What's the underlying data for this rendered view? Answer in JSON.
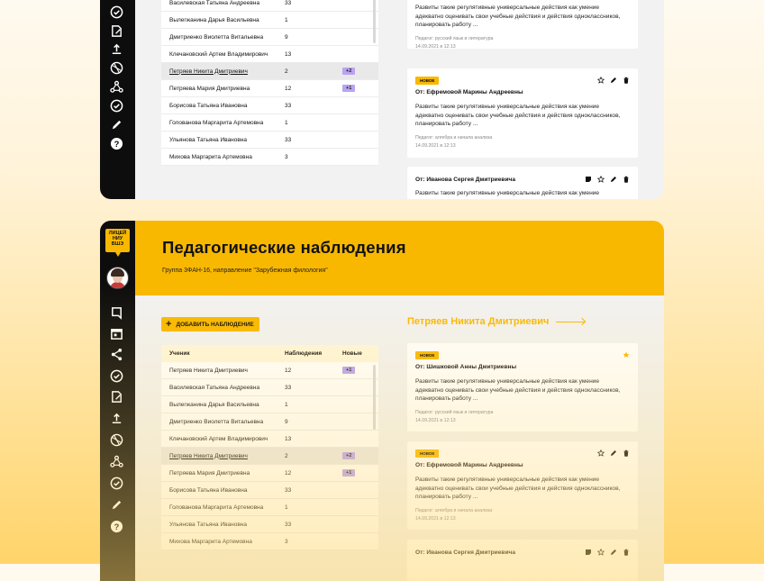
{
  "top_panel": {
    "table_rows": [
      {
        "name": "Василевская Татьяна Андреевна",
        "count": "33",
        "badge": "",
        "selected": false
      },
      {
        "name": "Вылегжанина Дарья Васильевна",
        "count": "1",
        "badge": "",
        "selected": false
      },
      {
        "name": "Дмитриенко Виолетта Витальевна",
        "count": "9",
        "badge": "",
        "selected": false
      },
      {
        "name": "Клечановский Артем Владимирович",
        "count": "13",
        "badge": "",
        "selected": false
      },
      {
        "name": "Петряев Никита Дмитриевич",
        "count": "2",
        "badge": "+2",
        "selected": true
      },
      {
        "name": "Петряева Мария Дмитриевна",
        "count": "12",
        "badge": "+1",
        "selected": false
      },
      {
        "name": "Борисова Татьяна Ивановна",
        "count": "33",
        "badge": "",
        "selected": false
      },
      {
        "name": "Голованова Маргарита Артемовна",
        "count": "1",
        "badge": "",
        "selected": false
      },
      {
        "name": "Ульянова Татьяна Ивановна",
        "count": "33",
        "badge": "",
        "selected": false
      },
      {
        "name": "Михова Маргарита Артемовна",
        "count": "3",
        "badge": "",
        "selected": false
      }
    ],
    "cards": [
      {
        "new": "",
        "from": "",
        "text": "Развиты такие регулятивные универсальные действия как умение адекватно оценивать свои учебные действия и действия одноклассников,  планировать работу ...",
        "subject": "Педагог: русский язык и литература",
        "date": "14.09.2021 в 12:13"
      },
      {
        "new": "НОВОЕ",
        "from": "От: Ефремовой Марины Андреевны",
        "text": "Развиты такие регулятивные универсальные действия как умение адекватно оценивать свои учебные действия и действия одноклассников,  планировать работу ...",
        "subject": "Педагог: алгебра и начала анализа",
        "date": "14.09.2021 в 12:13"
      },
      {
        "new": "",
        "from": "От: Иванова Сергея Дмитриевича",
        "text": "Развиты такие регулятивные универсальные действия как умение адекватно оценивать свои учебные действия и действия",
        "subject": "",
        "date": ""
      }
    ]
  },
  "bottom_panel": {
    "logo_text": [
      "ЛИЦЕЙ",
      "НИУ",
      "ВШЭ"
    ],
    "title": "Педагогические наблюдения",
    "subtitle": "Группа 3ФАН-16, направление \"Зарубежная филология\"",
    "add_button": "ДОБАВИТЬ НАБЛЮДЕНИЕ",
    "student_name": "Петряев Никита Дмитриевич",
    "table_headers": {
      "student": "Ученик",
      "observations": "Наблюдения",
      "new": "Новые"
    },
    "table_rows": [
      {
        "name": "Петряев Никита Дмитриевич",
        "count": "12",
        "badge": "+1",
        "selected": false
      },
      {
        "name": "Василевская Татьяна Андреевна",
        "count": "33",
        "badge": "",
        "selected": false
      },
      {
        "name": "Вылегжанина Дарья Васильевна",
        "count": "1",
        "badge": "",
        "selected": false
      },
      {
        "name": "Дмитриенко Виолетта Витальевна",
        "count": "9",
        "badge": "",
        "selected": false
      },
      {
        "name": "Клечановский Артем Владимирович",
        "count": "13",
        "badge": "",
        "selected": false
      },
      {
        "name": "Петряев Никита Дмитриевич",
        "count": "2",
        "badge": "+2",
        "selected": true
      },
      {
        "name": "Петряева Мария Дмитриевна",
        "count": "12",
        "badge": "+1",
        "selected": false
      },
      {
        "name": "Борисова Татьяна Ивановна",
        "count": "33",
        "badge": "",
        "selected": false
      },
      {
        "name": "Голованова Маргарита Артемовна",
        "count": "1",
        "badge": "",
        "selected": false
      },
      {
        "name": "Ульянова Татьяна Ивановна",
        "count": "33",
        "badge": "",
        "selected": false
      },
      {
        "name": "Михова Маргарита Артемовна",
        "count": "3",
        "badge": "",
        "selected": false
      }
    ],
    "cards": [
      {
        "new": "НОВОЕ",
        "from": "От: Шишковой Анны Дмитриевны",
        "text": "Развиты такие регулятивные универсальные действия как умение адекватно оценивать свои учебные действия и действия одноклассников,  планировать работу ...",
        "subject": "Педагог: русский язык и литература",
        "date": "14.09.2021 в 12:13"
      },
      {
        "new": "НОВОЕ",
        "from": "От: Ефремовой Марины Андреевны",
        "text": "Развиты такие регулятивные универсальные действия как умение адекватно оценивать свои учебные действия и действия одноклассников,  планировать работу ...",
        "subject": "Педагог: алгебра и начала анализа",
        "date": "14.09.2021 в 12:13"
      },
      {
        "new": "",
        "from": "От: Иванова Сергея Дмитриевича",
        "text": "",
        "subject": "",
        "date": ""
      }
    ]
  },
  "colors": {
    "accent": "#f9b800",
    "badge": "#b9a4f0",
    "sidebar": "#0d0d0d"
  }
}
